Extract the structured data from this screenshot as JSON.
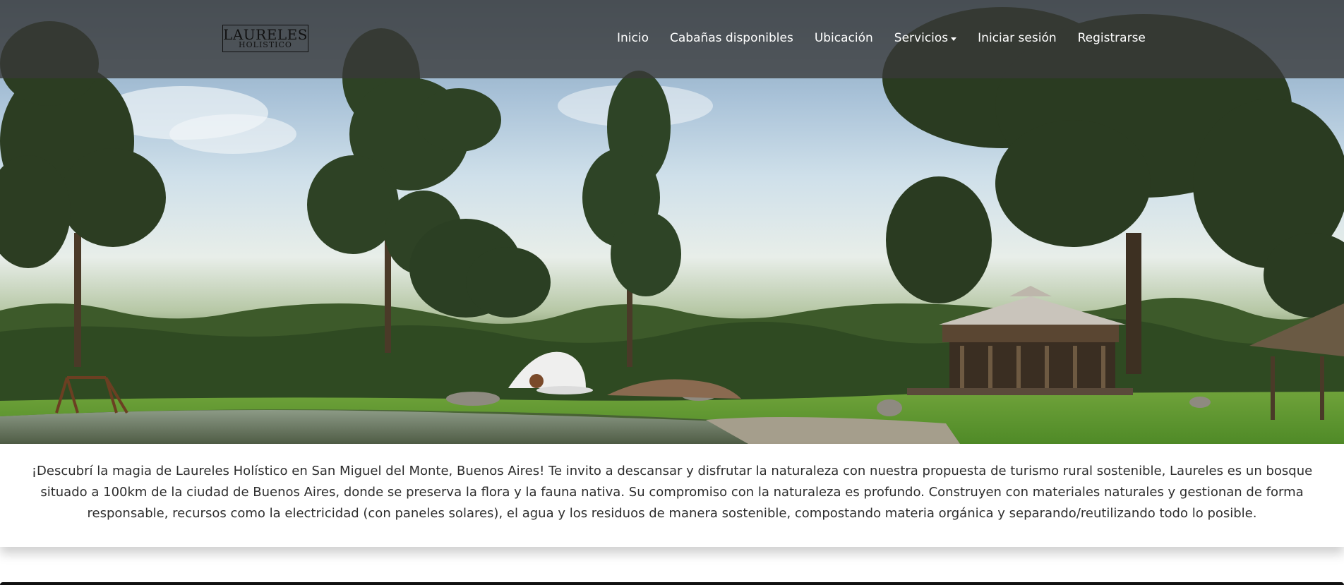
{
  "brand": {
    "name": "LAURELES",
    "subtitle": "HOLISTICO"
  },
  "nav": {
    "items": [
      {
        "label": "Inicio"
      },
      {
        "label": "Cabañas disponibles"
      },
      {
        "label": "Ubicación"
      },
      {
        "label": "Servicios",
        "dropdown": true
      },
      {
        "label": "Iniciar sesión"
      },
      {
        "label": "Registrarse"
      }
    ]
  },
  "hero": {
    "image": "forest-lake-cabins-photo"
  },
  "intro": {
    "text": "¡Descubrí la magia de Laureles Holístico en San Miguel del Monte, Buenos Aires! Te invito a descansar y disfrutar la naturaleza con nuestra propuesta de turismo rural sostenible, Laureles es un bosque situado a 100km de la ciudad de Buenos Aires, donde se preserva la flora y la fauna nativa. Su compromiso con la naturaleza es profundo. Construyen con materiales naturales y gestionan de forma responsable, recursos como la electricidad (con paneles solares), el agua y los residuos de manera sostenible, compostando materia orgánica y separando/reutilizando todo lo posible."
  },
  "colors": {
    "navbar_bg": "#383838",
    "nav_text": "#ffffff",
    "body_text": "#2d2d2d"
  }
}
